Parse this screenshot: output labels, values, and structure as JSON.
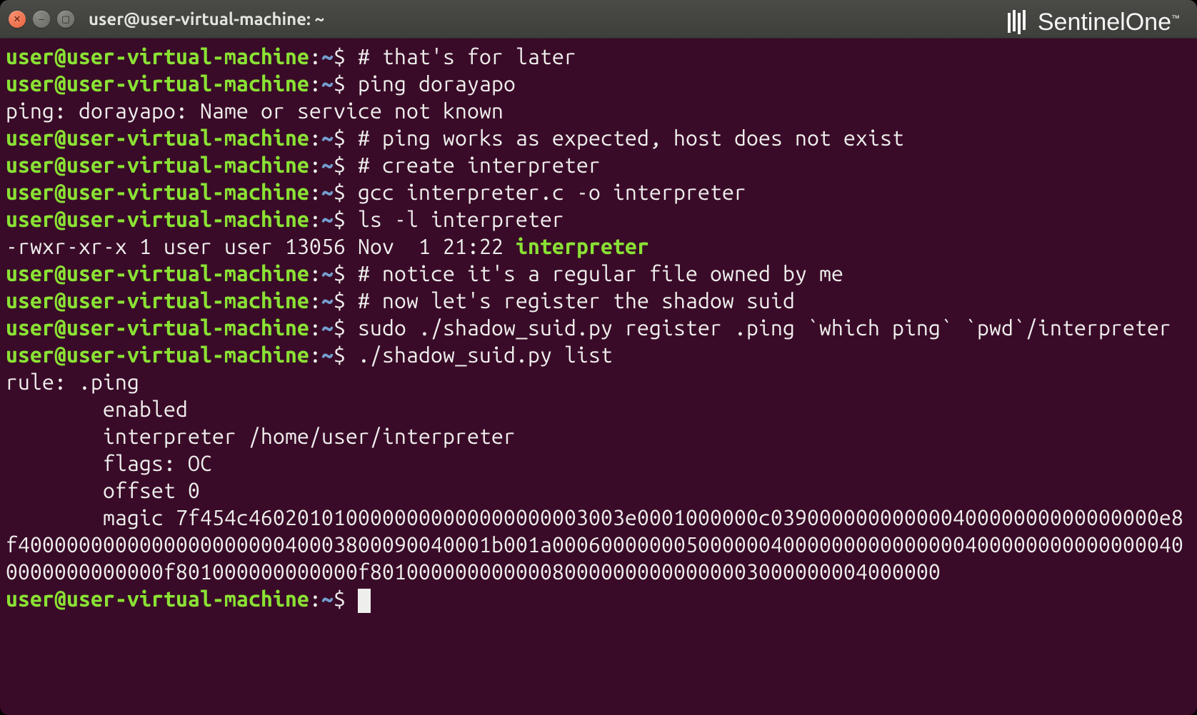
{
  "window": {
    "title": "user@user-virtual-machine: ~"
  },
  "prompt": {
    "user_host": "user@user-virtual-machine",
    "sep": ":",
    "path": "~",
    "sigil": "$"
  },
  "lines": [
    {
      "type": "prompt",
      "cmd": "# that's for later"
    },
    {
      "type": "prompt",
      "cmd": "ping dorayapo"
    },
    {
      "type": "out",
      "text": "ping: dorayapo: Name or service not known"
    },
    {
      "type": "prompt",
      "cmd": "# ping works as expected, host does not exist"
    },
    {
      "type": "prompt",
      "cmd": "# create interpreter"
    },
    {
      "type": "prompt",
      "cmd": "gcc interpreter.c -o interpreter"
    },
    {
      "type": "prompt",
      "cmd": "ls -l interpreter"
    },
    {
      "type": "ls",
      "perm_etc": "-rwxr-xr-x 1 user user 13056 Nov  1 21:22 ",
      "filename": "interpreter"
    },
    {
      "type": "prompt",
      "cmd": "# notice it's a regular file owned by me"
    },
    {
      "type": "prompt",
      "cmd": "# now let's register the shadow suid"
    },
    {
      "type": "prompt",
      "cmd": "sudo ./shadow_suid.py register .ping `which ping` `pwd`/interpreter"
    },
    {
      "type": "prompt",
      "cmd": "./shadow_suid.py list"
    },
    {
      "type": "out",
      "text": "rule: .ping"
    },
    {
      "type": "out",
      "text": "        enabled"
    },
    {
      "type": "out",
      "text": "        interpreter /home/user/interpreter"
    },
    {
      "type": "out",
      "text": "        flags: OC"
    },
    {
      "type": "out",
      "text": "        offset 0"
    },
    {
      "type": "out",
      "text": "        magic 7f454c4602010100000000000000000003003e0001000000c03900000000000040000000000000000e8f400000000000000000000040003800090040001b001a00060000000500000040000000000000004000000000000000400000000000000f801000000000000f80100000000000080000000000000003000000004000000"
    },
    {
      "type": "out",
      "text": ""
    },
    {
      "type": "cursor"
    }
  ],
  "watermark": {
    "brand1": "Sentinel",
    "brand2": "One",
    "tm": "™"
  }
}
